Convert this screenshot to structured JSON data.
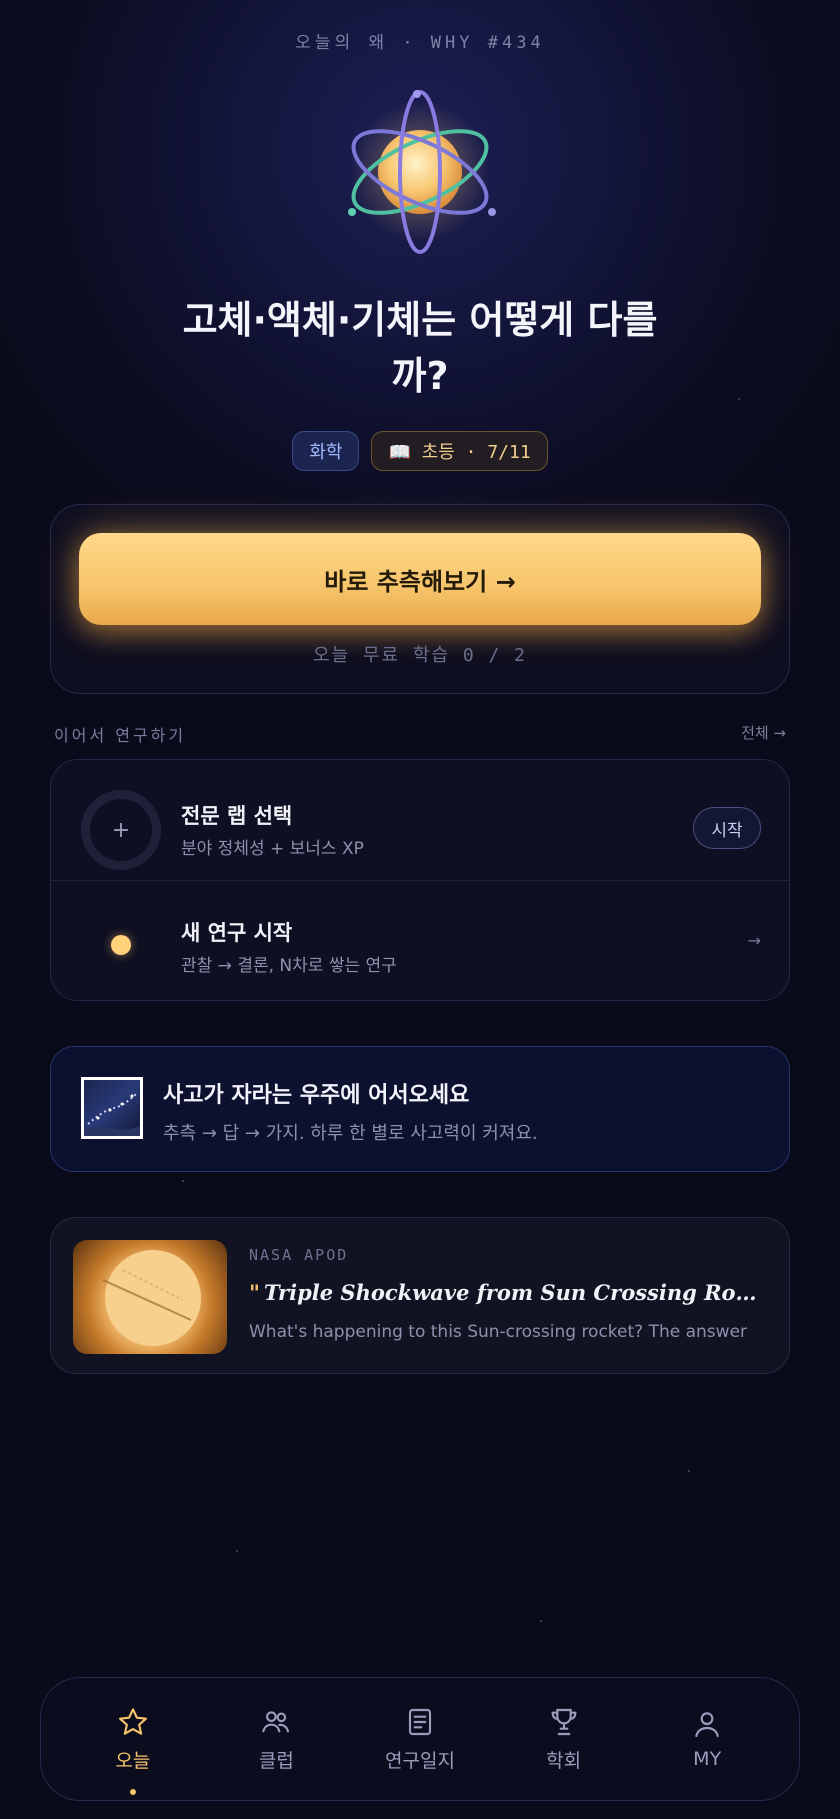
{
  "header": {
    "kicker": "오늘의 왜 · WHY #434",
    "title": "고체·액체·기체는 어떻게 다를까?"
  },
  "tags": {
    "subject": "화학",
    "grade_icon": "book-icon",
    "grade_label": "📖 초등 · 7/11"
  },
  "hero": {
    "cta_label": "바로 추측해보기 →",
    "free_count": "오늘 무료 학습 0 / 2"
  },
  "continue": {
    "title": "이어서 연구하기",
    "see_all": "전체 →",
    "items": [
      {
        "title": "전문 랩 선택",
        "subtitle": "분야 정체성 + 보너스 XP",
        "action": "시작",
        "icon": "plus-icon"
      },
      {
        "title": "새 연구 시작",
        "subtitle": "관찰 → 결론, N차로 쌓는 연구",
        "action": "→",
        "icon": "dot-icon"
      }
    ]
  },
  "welcome": {
    "title": "사고가 자라는 우주에 어서오세요",
    "subtitle": "추측 → 답 → 가지. 하루 한 별로 사고력이 커져요."
  },
  "apod": {
    "source": "NASA APOD",
    "quote_mark": "\"",
    "title": "Triple Shockwave from Sun Crossing Rocket",
    "description": "What's happening to this Sun-crossing rocket? The answer"
  },
  "tabbar": {
    "tabs": [
      {
        "label": "오늘",
        "icon": "star-icon",
        "active": true
      },
      {
        "label": "클럽",
        "icon": "people-icon",
        "active": false
      },
      {
        "label": "연구일지",
        "icon": "journal-icon",
        "active": false
      },
      {
        "label": "학회",
        "icon": "trophy-icon",
        "active": false
      },
      {
        "label": "MY",
        "icon": "person-icon",
        "active": false
      }
    ]
  },
  "colors": {
    "accent": "#f6c46a",
    "background": "#0a0b1a",
    "subject_tag": "#9fb6ff"
  }
}
